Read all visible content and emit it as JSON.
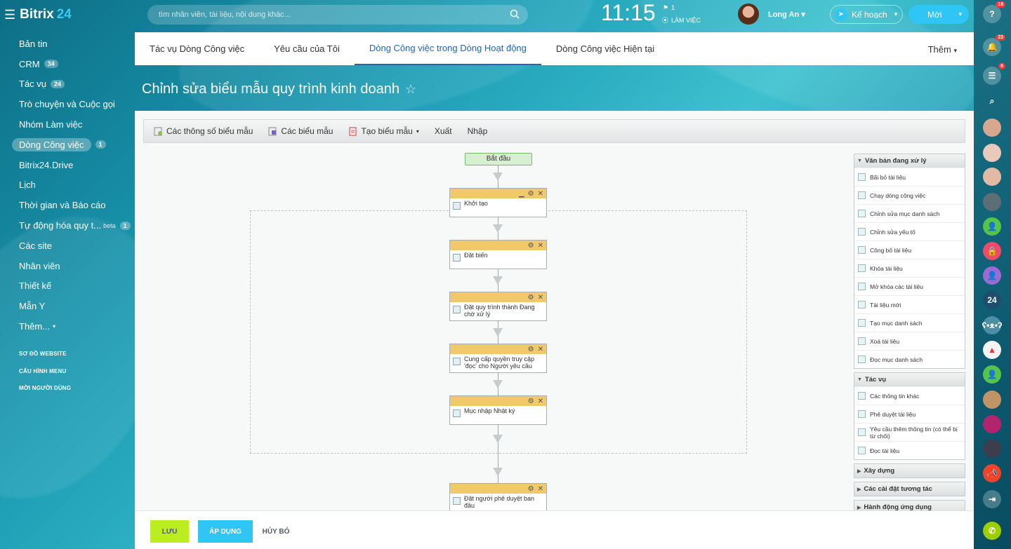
{
  "brand": {
    "name": "Bitrix",
    "number": "24"
  },
  "search": {
    "placeholder": "tìm nhân viên, tài liệu, nội dung khác..."
  },
  "clock": "11:15",
  "flag_count": "1",
  "work_status": "LÀM VIỆC",
  "user": {
    "name": "Long An"
  },
  "plan_label": "Kế hoạch",
  "invite_label": "Mời",
  "sidebar": {
    "items": [
      {
        "label": "Bản tin",
        "badge": ""
      },
      {
        "label": "CRM",
        "badge": "34"
      },
      {
        "label": "Tác vụ",
        "badge": "24"
      },
      {
        "label": "Trò chuyện và Cuộc gọi",
        "badge": ""
      },
      {
        "label": "Nhóm Làm việc",
        "badge": ""
      },
      {
        "label": "Dòng Công việc",
        "badge": "1"
      },
      {
        "label": "Bitrix24.Drive",
        "badge": ""
      },
      {
        "label": "Lịch",
        "badge": ""
      },
      {
        "label": "Thời gian và Báo cáo",
        "badge": ""
      },
      {
        "label": "Tự động hóa quy t...",
        "badge": "1",
        "beta": "beta"
      },
      {
        "label": "Các site",
        "badge": ""
      },
      {
        "label": "Nhân viên",
        "badge": ""
      },
      {
        "label": "Thiết kế",
        "badge": ""
      },
      {
        "label": "Mẫn Y",
        "badge": ""
      },
      {
        "label": "Thêm...",
        "badge": ""
      }
    ],
    "small_links": [
      "SƠ ĐỒ WEBSITE",
      "CẤU HÌNH MENU",
      "MỜI NGƯỜI DÙNG"
    ]
  },
  "tabs": [
    "Tác vụ Dòng Công việc",
    "Yêu cầu của Tôi",
    "Dòng Công việc trong Dòng Hoạt động",
    "Dòng Công việc Hiện tại"
  ],
  "tabs_more": "Thêm",
  "page_title": "Chỉnh sửa biểu mẫu quy trình kinh doanh",
  "toolbar": {
    "params": "Các thông số biểu mẫu",
    "templates": "Các biểu mẫu",
    "create": "Tạo biểu mẫu",
    "export": "Xuất",
    "import": "Nhập"
  },
  "designer": {
    "start": "Bắt đầu",
    "activities": [
      {
        "title": "Khởi tạo"
      },
      {
        "title": "Đặt biến"
      },
      {
        "title": "Đặt quy trình thành Đang chờ xử lý"
      },
      {
        "title": "Cung cấp quyền truy cập 'đọc' cho Người yêu cầu"
      },
      {
        "title": "Mục nhập Nhật ký"
      },
      {
        "title": "Đặt người phê duyệt ban đầu"
      }
    ]
  },
  "panel": {
    "groups": [
      {
        "title": "Văn bản đang xử lý",
        "open": true,
        "items": [
          "Bãi bỏ tài liệu",
          "Chạy dòng công việc",
          "Chỉnh sửa mục danh sách",
          "Chỉnh sửa yếu tố",
          "Công bố tài liệu",
          "Khóa tài liệu",
          "Mở khóa các tài liệu",
          "Tài liệu mới",
          "Tạo mục danh sách",
          "Xoá tài liệu",
          "Đọc mục danh sách"
        ]
      },
      {
        "title": "Tác vụ",
        "open": true,
        "items": [
          "Các thông tin khác",
          "Phê duyệt tài liệu",
          "Yêu cầu thêm thông tin (có thể bị từ chối)",
          "Đọc tài liệu"
        ]
      },
      {
        "title": "Xây dựng",
        "open": false,
        "items": []
      },
      {
        "title": "Các cài đặt tương tác",
        "open": false,
        "items": []
      },
      {
        "title": "Hành động ứng dụng",
        "open": false,
        "items": []
      }
    ]
  },
  "footer": {
    "save": "LƯU",
    "apply": "ÁP DỤNG",
    "cancel": "HỦY BỎ"
  },
  "rail": {
    "help_badge": "18",
    "notif_badge": "23",
    "chat_badge": "6",
    "b24_label": "24"
  },
  "colors": {
    "accent": "#2fc6f6",
    "save_green": "#bbed21",
    "active_tab": "#2067b0",
    "activity_header": "#f2c96a"
  }
}
